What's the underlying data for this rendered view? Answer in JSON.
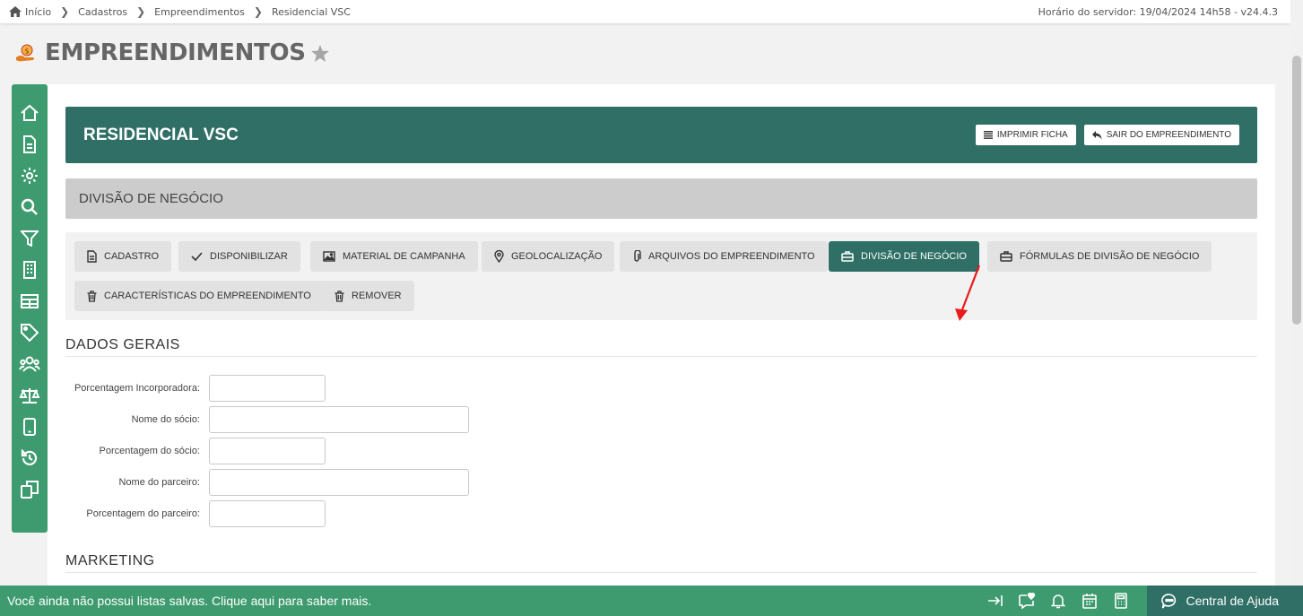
{
  "breadcrumb": [
    {
      "label": "Início"
    },
    {
      "label": "Cadastros"
    },
    {
      "label": "Empreendimentos"
    },
    {
      "label": "Residencial VSC"
    }
  ],
  "server_time": "Horário do servidor: 19/04/2024 14h58 - v24.4.3",
  "page": {
    "title": "EMPREENDIMENTOS"
  },
  "sidebar": {
    "items": [
      {
        "icon": "home-icon"
      },
      {
        "icon": "document-icon"
      },
      {
        "icon": "gear-icon"
      },
      {
        "icon": "search-icon"
      },
      {
        "icon": "filter-icon"
      },
      {
        "icon": "building-icon"
      },
      {
        "icon": "table-icon"
      },
      {
        "icon": "tag-icon"
      },
      {
        "icon": "users-icon"
      },
      {
        "icon": "balance-icon"
      },
      {
        "icon": "mobile-icon"
      },
      {
        "icon": "history-icon"
      },
      {
        "icon": "copy-icon"
      }
    ]
  },
  "header": {
    "title": "RESIDENCIAL VSC",
    "print_label": "IMPRIMIR FICHA",
    "exit_label": "SAIR DO EMPREENDIMENTO"
  },
  "subheader": {
    "title": "DIVISÃO DE NEGÓCIO"
  },
  "tabs": [
    {
      "label": "CADASTRO",
      "icon": "file-icon",
      "active": false
    },
    {
      "label": "DISPONIBILIZAR",
      "icon": "check-icon",
      "active": false
    },
    {
      "label": "MATERIAL DE CAMPANHA",
      "icon": "image-icon",
      "active": false
    },
    {
      "label": "GEOLOCALIZAÇÃO",
      "icon": "map-pin-icon",
      "active": false
    },
    {
      "label": "ARQUIVOS DO EMPREENDIMENTO",
      "icon": "paperclip-icon",
      "active": false
    },
    {
      "label": "DIVISÃO DE NEGÓCIO",
      "icon": "briefcase-icon",
      "active": true
    },
    {
      "label": "FÓRMULAS DE DIVISÃO DE NEGÓCIO",
      "icon": "briefcase-icon",
      "active": false
    },
    {
      "label": "CARACTERÍSTICAS DO EMPREENDIMENTO",
      "icon": "trash-icon",
      "active": false
    },
    {
      "label": "REMOVER",
      "icon": "trash-icon",
      "active": false
    }
  ],
  "dados_gerais": {
    "title": "DADOS GERAIS",
    "fields": [
      {
        "label": "Porcentagem Incorporadora:",
        "value": ""
      },
      {
        "label": "Nome do sócio:",
        "value": ""
      },
      {
        "label": "Porcentagem do sócio:",
        "value": ""
      },
      {
        "label": "Nome do parceiro:",
        "value": ""
      },
      {
        "label": "Porcentagem do parceiro:",
        "value": ""
      }
    ]
  },
  "marketing": {
    "title": "MARKETING"
  },
  "bottom_bar": {
    "message": "Você ainda não possui listas salvas. Clique aqui para saber mais.",
    "icons": [
      "arrow-to-right-icon",
      "heart-chat-icon",
      "bell-icon",
      "calendar-icon",
      "calculator-icon"
    ],
    "help_label": "Central de Ajuda"
  },
  "colors": {
    "accent": "#2f6f66",
    "sidebar": "#3e9b6f",
    "annotation_arrow": "#e81a1a"
  }
}
